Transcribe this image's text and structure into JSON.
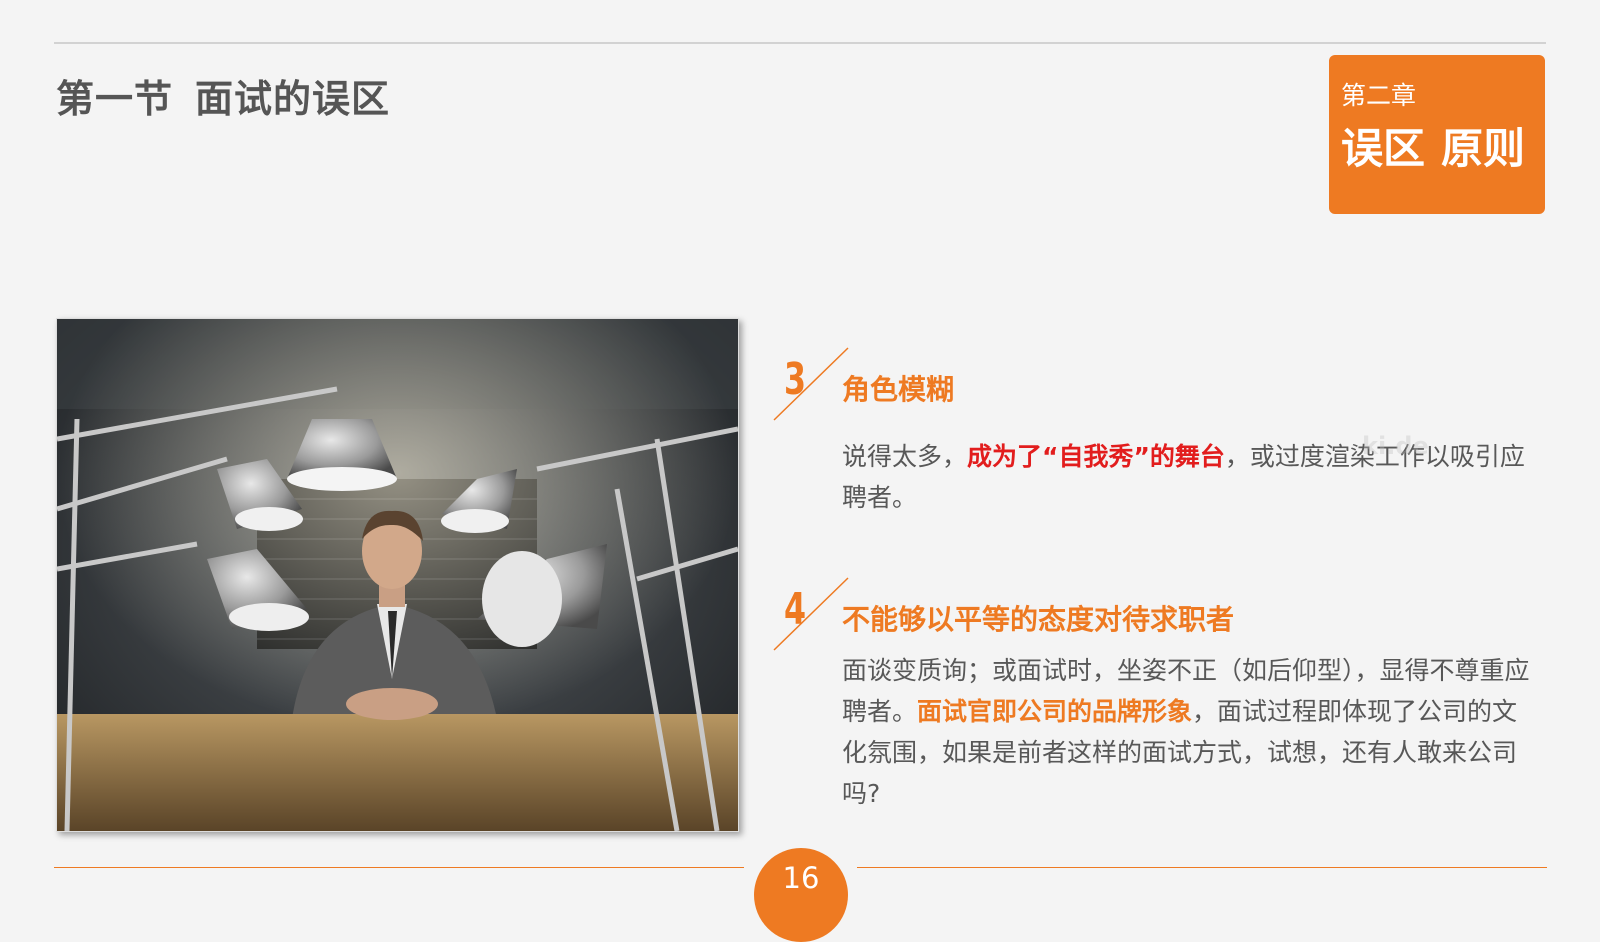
{
  "header": {
    "section_label": "第一节",
    "section_title": "面试的误区",
    "chapter_label": "第二章",
    "chapter_title_1": "误区",
    "chapter_title_2": "原则"
  },
  "photo": {
    "description_icon": "interview-photo"
  },
  "points": [
    {
      "number": "3",
      "heading": "角色模糊",
      "text_1": "说得太多，",
      "highlight": "成为了“自我秀”的舞台",
      "text_2": "，或过度渲染工作以吸引应聘者。"
    },
    {
      "number": "4",
      "heading": "不能够以平等的态度对待求职者",
      "text_1": "面谈变质询；或面试时，坐姿不正（如后仰型），显得不尊重应聘者。",
      "highlight": "面试官即公司的品牌形象",
      "text_2": "，面试过程即体现了公司的文化氛围，如果是前者这样的面试方式，试想，还有人敢来公司吗?"
    }
  ],
  "watermark": "ki.de",
  "footer": {
    "page_number": "16"
  },
  "colors": {
    "accent": "#ee7a22",
    "highlight_red": "#e21d1d",
    "text": "#585858"
  }
}
